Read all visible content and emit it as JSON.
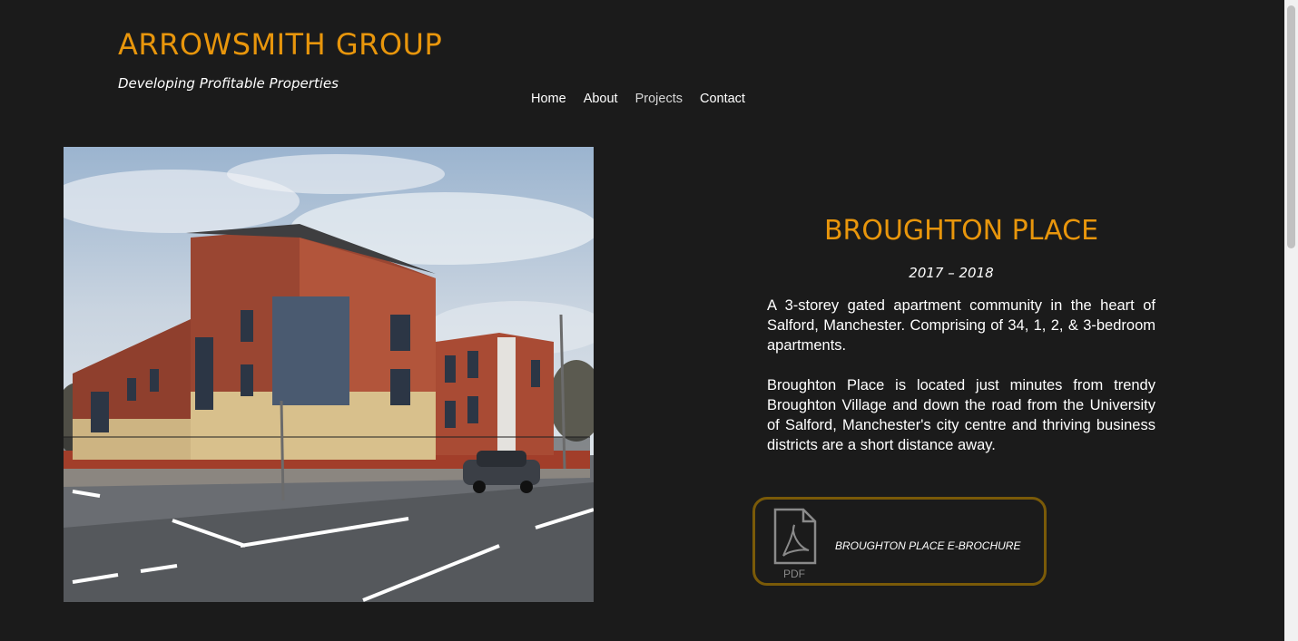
{
  "brand": {
    "title": "ARROWSMITH GROUP",
    "tagline": "Developing Profitable Properties",
    "accent_color": "#e8960c"
  },
  "nav": {
    "items": [
      {
        "label": "Home"
      },
      {
        "label": "About"
      },
      {
        "label": "Projects",
        "active": true
      },
      {
        "label": "Contact"
      }
    ]
  },
  "project": {
    "title": "BROUGHTON PLACE",
    "years": "2017 – 2018",
    "paragraphs": [
      "A 3-storey gated apartment community in the heart of Salford, Manchester. Comprising of 34, 1, 2, & 3-bedroom apartments.",
      "Broughton Place is located just minutes from trendy Broughton Village and down the road from the University of Salford, Manchester's city centre and thriving business districts are a short distance away."
    ],
    "photo_icon": "building-photo"
  },
  "brochure": {
    "icon": "pdf-file-icon",
    "icon_caption": "PDF",
    "label": "BROUGHTON PLACE E-BROCHURE",
    "border_color": "#7a5a08"
  }
}
